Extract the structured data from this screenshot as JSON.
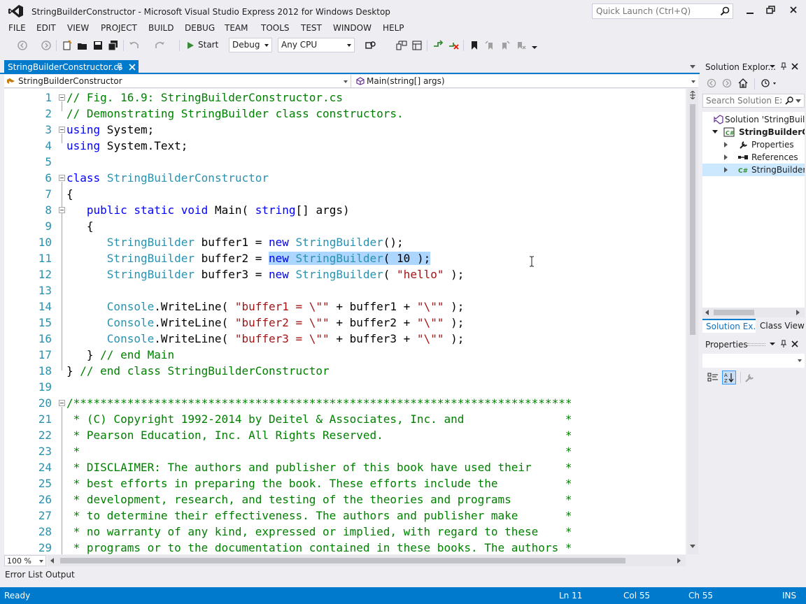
{
  "window": {
    "title": "StringBuilderConstructor - Microsoft Visual Studio Express 2012 for Windows Desktop",
    "quick_launch_placeholder": "Quick Launch (Ctrl+Q)"
  },
  "menu": [
    "FILE",
    "EDIT",
    "VIEW",
    "PROJECT",
    "BUILD",
    "DEBUG",
    "TEAM",
    "TOOLS",
    "TEST",
    "WINDOW",
    "HELP"
  ],
  "toolbar": {
    "start_label": "Start",
    "configuration": "Debug",
    "platform": "Any CPU"
  },
  "document": {
    "tab_label": "StringBuilderConstructor.cs",
    "nav_class": "StringBuilderConstructor",
    "nav_member": "Main(string[] args)"
  },
  "editor": {
    "lines": [
      {
        "num": "1",
        "text": "// Fig. 16.9: StringBuilderConstructor.cs"
      },
      {
        "num": "2",
        "text": "// Demonstrating StringBuilder class constructors."
      },
      {
        "num": "3",
        "text": "using System;"
      },
      {
        "num": "4",
        "text": "using System.Text;"
      },
      {
        "num": "5",
        "text": ""
      },
      {
        "num": "6",
        "text": "class StringBuilderConstructor"
      },
      {
        "num": "7",
        "text": "{"
      },
      {
        "num": "8",
        "text": "   public static void Main( string[] args)"
      },
      {
        "num": "9",
        "text": "   {"
      },
      {
        "num": "10",
        "text": "      StringBuilder buffer1 = new StringBuilder();"
      },
      {
        "num": "11",
        "text": "      StringBuilder buffer2 = new StringBuilder( 10 );"
      },
      {
        "num": "12",
        "text": "      StringBuilder buffer3 = new StringBuilder( \"hello\" );"
      },
      {
        "num": "13",
        "text": ""
      },
      {
        "num": "14",
        "text": "      Console.WriteLine( \"buffer1 = \\\"\" + buffer1 + \"\\\"\" );"
      },
      {
        "num": "15",
        "text": "      Console.WriteLine( \"buffer2 = \\\"\" + buffer2 + \"\\\"\" );"
      },
      {
        "num": "16",
        "text": "      Console.WriteLine( \"buffer3 = \\\"\" + buffer3 + \"\\\"\" );"
      },
      {
        "num": "17",
        "text": "   } // end Main"
      },
      {
        "num": "18",
        "text": "} // end class StringBuilderConstructor"
      },
      {
        "num": "19",
        "text": ""
      },
      {
        "num": "20",
        "text": "/**************************************************************************"
      },
      {
        "num": "21",
        "text": " * (C) Copyright 1992-2014 by Deitel & Associates, Inc. and               *"
      },
      {
        "num": "22",
        "text": " * Pearson Education, Inc. All Rights Reserved.                           *"
      },
      {
        "num": "23",
        "text": " *                                                                        *"
      },
      {
        "num": "24",
        "text": " * DISCLAIMER: The authors and publisher of this book have used their     *"
      },
      {
        "num": "25",
        "text": " * best efforts in preparing the book. These efforts include the          *"
      },
      {
        "num": "26",
        "text": " * development, research, and testing of the theories and programs        *"
      },
      {
        "num": "27",
        "text": " * to determine their effectiveness. The authors and publisher make       *"
      },
      {
        "num": "28",
        "text": " * no warranty of any kind, expressed or implied, with regard to these    *"
      },
      {
        "num": "29",
        "text": " * programs or to the documentation contained in these books. The authors *"
      }
    ],
    "zoom": "100 %"
  },
  "bottom_tabs": [
    "Error List",
    "Output"
  ],
  "status": {
    "state": "Ready",
    "line": "Ln 11",
    "col": "Col 55",
    "ch": "Ch 55",
    "mode": "INS"
  },
  "solution_explorer": {
    "title": "Solution Explor...",
    "search_placeholder": "Search Solution Exp",
    "items": [
      "Solution 'StringBuilderConstructor'",
      "StringBuilderConstructor",
      "Properties",
      "References",
      "StringBuilderConstructor.cs"
    ],
    "tabs": [
      "Solution Ex...",
      "Class View"
    ]
  },
  "properties": {
    "title": "Properties"
  },
  "colors": {
    "accent": "#007acc",
    "keyword": "#0000ff",
    "type": "#2b91af",
    "string": "#a31515",
    "comment": "#008000",
    "selection": "#add6ff"
  }
}
